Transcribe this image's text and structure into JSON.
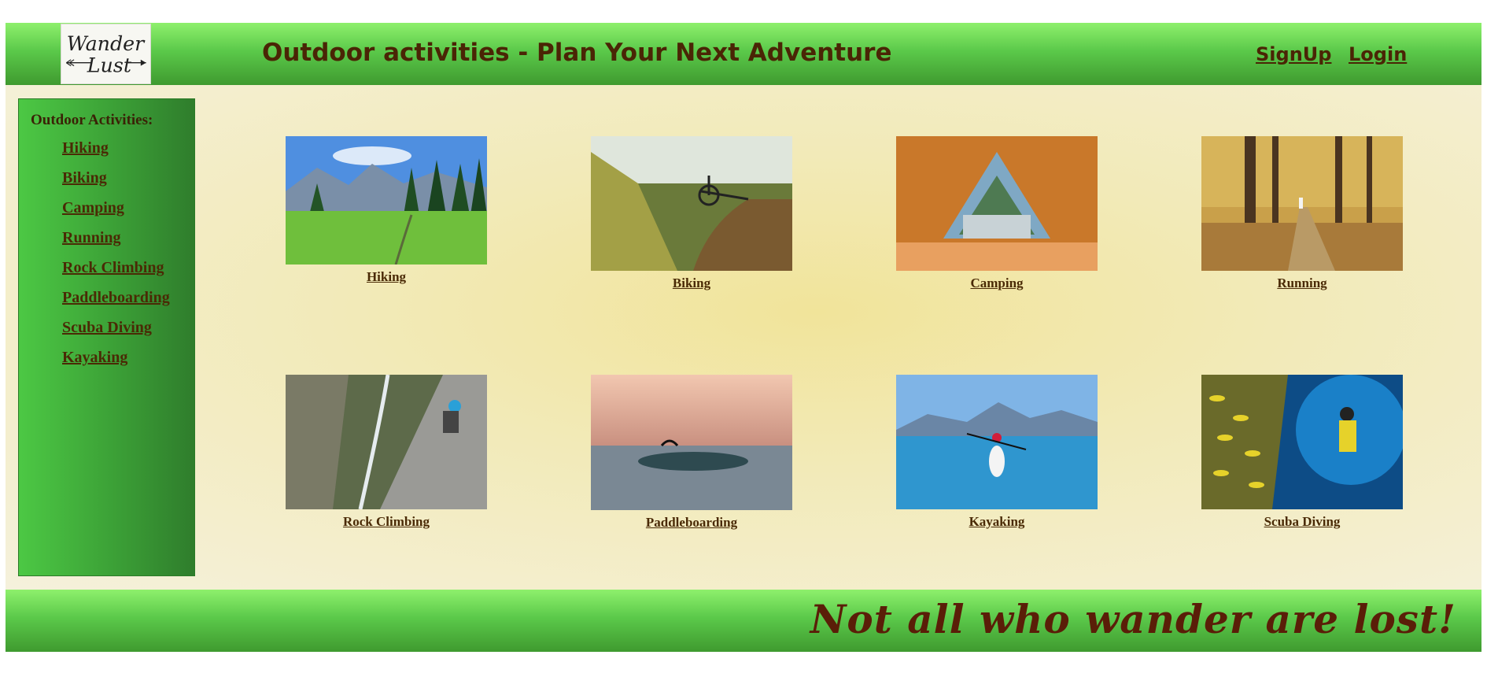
{
  "header": {
    "logo_text": "Wander Lust",
    "title": "Outdoor activities - Plan Your Next Adventure",
    "signup_label": "SignUp",
    "login_label": "Login"
  },
  "sidebar": {
    "heading": "Outdoor Activities:",
    "items": [
      {
        "label": "Hiking"
      },
      {
        "label": "Biking"
      },
      {
        "label": "Camping"
      },
      {
        "label": "Running"
      },
      {
        "label": "Rock Climbing"
      },
      {
        "label": "Paddleboarding"
      },
      {
        "label": "Scuba Diving"
      },
      {
        "label": "Kayaking"
      }
    ]
  },
  "gallery": {
    "tiles": [
      {
        "caption": "Hiking",
        "image": "mountain-meadow-photo"
      },
      {
        "caption": "Biking",
        "image": "bike-trail-photo"
      },
      {
        "caption": "Camping",
        "image": "tent-interior-photo"
      },
      {
        "caption": "Running",
        "image": "autumn-forest-path-photo"
      },
      {
        "caption": "Rock Climbing",
        "image": "cliff-climber-photo"
      },
      {
        "caption": "Paddleboarding",
        "image": "paddleboard-sunset-photo"
      },
      {
        "caption": "Kayaking",
        "image": "lake-kayak-photo"
      },
      {
        "caption": "Scuba Diving",
        "image": "diver-fish-photo"
      }
    ]
  },
  "footer": {
    "tagline": "Not all who wander are lost!"
  },
  "colors": {
    "header_green": "#5bc94a",
    "text_brown": "#4a2a05",
    "tagline_brown": "#5a1e08",
    "background_cream": "#f2eab8"
  }
}
